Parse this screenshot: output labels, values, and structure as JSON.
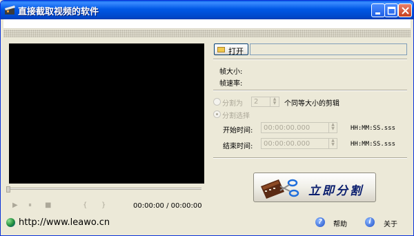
{
  "window": {
    "title": "直接截取视频的软件"
  },
  "player": {
    "time_display": "00:00:00 / 00:00:00",
    "controls": {
      "play": "▶",
      "pause": "⏸",
      "stop": "■",
      "mark_in": "{",
      "mark_out": "}"
    }
  },
  "footer": {
    "url": "http://www.leawo.cn",
    "help_label": "帮助",
    "about_label": "关于"
  },
  "file": {
    "open_label": "打开",
    "path_value": ""
  },
  "info": {
    "frame_size_label": "帧大小:",
    "frame_rate_label": "帧速率:"
  },
  "split": {
    "by_count_label": "分割为",
    "count_value": "2",
    "count_suffix": "个同等大小的剪辑",
    "by_selection_label": "分割选择",
    "start_label": "开始时间:",
    "start_value": "00:00:00.000",
    "end_label": "结束时间:",
    "end_value": "00:00:00.000",
    "format_hint": "HH:MM:SS.sss"
  },
  "actions": {
    "cut_now_label": "立即分割"
  },
  "icons": {
    "app": "film-clapper-icon",
    "open": "folder-icon",
    "url": "globe-icon",
    "help": "help-icon",
    "about": "info-icon",
    "cut": "scissors-film-icon"
  },
  "colors": {
    "titlebar": "#0058E6",
    "window_bg": "#ECE9D8",
    "video_bg": "#000000",
    "disabled_text": "#ACA899",
    "cut_label": "#0A1E6E"
  }
}
